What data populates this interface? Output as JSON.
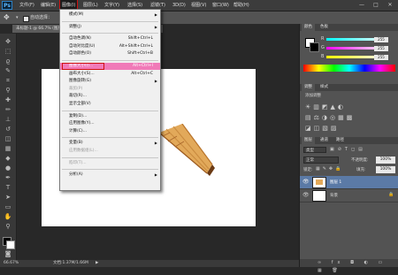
{
  "app": {
    "logo": "Ps"
  },
  "menubar": {
    "items": [
      "文件(F)",
      "编辑(E)",
      "图像(I)",
      "图层(L)",
      "文字(Y)",
      "选择(S)",
      "滤镜(T)",
      "3D(D)",
      "视图(V)",
      "窗口(W)",
      "帮助(H)"
    ],
    "window_controls": [
      "—",
      "□",
      "✕"
    ]
  },
  "options_bar": {
    "auto_select_label": "自动选择："
  },
  "document": {
    "tab_label": "未标题-1 @ 66.7% (图层 1, RGB/8) *"
  },
  "statusbar": {
    "zoom": "66.67%",
    "doc_info": "文档:1.37M/1.66M"
  },
  "image_menu": {
    "items": [
      {
        "label": "模式(M)",
        "submenu": true
      },
      {
        "sep": true
      },
      {
        "label": "调整(J)",
        "submenu": true
      },
      {
        "sep": true
      },
      {
        "label": "自动色调(N)",
        "shortcut": "Shift+Ctrl+L"
      },
      {
        "label": "自动对比度(U)",
        "shortcut": "Alt+Shift+Ctrl+L"
      },
      {
        "label": "自动颜色(O)",
        "shortcut": "Shift+Ctrl+B"
      },
      {
        "sep": true
      },
      {
        "label": "图像大小(I)...",
        "shortcut": "Alt+Ctrl+I",
        "highlight": true
      },
      {
        "label": "画布大小(S)...",
        "shortcut": "Alt+Ctrl+C"
      },
      {
        "label": "图像旋转(G)",
        "submenu": true
      },
      {
        "label": "裁剪(P)",
        "disabled": true
      },
      {
        "label": "裁切(R)..."
      },
      {
        "label": "显示全部(V)"
      },
      {
        "sep": true
      },
      {
        "label": "复制(D)..."
      },
      {
        "label": "应用图像(Y)..."
      },
      {
        "label": "计算(C)..."
      },
      {
        "sep": true
      },
      {
        "label": "变量(B)",
        "submenu": true
      },
      {
        "label": "应用数据组(L)...",
        "disabled": true
      },
      {
        "sep": true
      },
      {
        "label": "陷印(T)...",
        "disabled": true
      },
      {
        "sep": true
      },
      {
        "label": "分析(A)",
        "submenu": true
      }
    ]
  },
  "color_panel": {
    "tabs": [
      "颜色",
      "色板"
    ],
    "channels": [
      {
        "name": "R",
        "value": "255"
      },
      {
        "name": "G",
        "value": "255"
      },
      {
        "name": "B",
        "value": "255"
      }
    ]
  },
  "adjust_panel": {
    "tabs": [
      "调整",
      "样式"
    ],
    "add_label": "添加调整"
  },
  "layers_panel": {
    "tabs": [
      "图层",
      "通道",
      "路径"
    ],
    "kind": "类型",
    "blend_mode": "正常",
    "opacity_label": "不透明度:",
    "opacity_value": "100%",
    "lock_label": "锁定:",
    "fill_label": "填充:",
    "fill_value": "100%",
    "layers": [
      {
        "name": "图层 1"
      },
      {
        "name": "背景"
      }
    ]
  },
  "colors": {
    "accent_red": "#d01010",
    "highlight_pink": "#f07ab8",
    "menubar": "#3c3c3c",
    "panel": "#535353"
  }
}
